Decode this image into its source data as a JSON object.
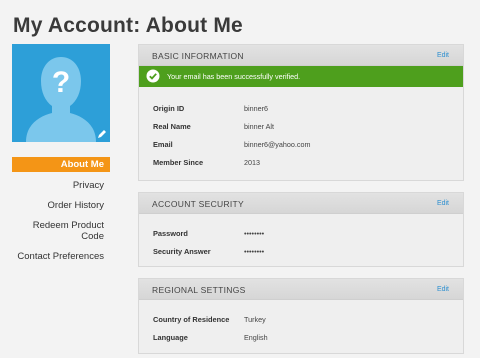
{
  "page": {
    "title": "My Account: About Me"
  },
  "nav": {
    "items": [
      {
        "label": "About Me",
        "active": true
      },
      {
        "label": "Privacy"
      },
      {
        "label": "Order History"
      },
      {
        "label": "Redeem Product Code"
      },
      {
        "label": "Contact Preferences"
      }
    ]
  },
  "colors": {
    "accent": "#f49516",
    "avatar_bg": "#2d9fd8",
    "success": "#4e9f1d",
    "link": "#2d8fd0"
  },
  "basic": {
    "title": "BASIC INFORMATION",
    "edit": "Edit",
    "success": "Your email has been successfully verified.",
    "rows": [
      {
        "label": "Origin ID",
        "value": "binner6"
      },
      {
        "label": "Real Name",
        "value": "binner Alt"
      },
      {
        "label": "Email",
        "value": "binner6@yahoo.com"
      },
      {
        "label": "Member Since",
        "value": "2013"
      }
    ]
  },
  "security": {
    "title": "ACCOUNT SECURITY",
    "edit": "Edit",
    "rows": [
      {
        "label": "Password",
        "value": "••••••••"
      },
      {
        "label": "Security Answer",
        "value": "••••••••"
      }
    ]
  },
  "regional": {
    "title": "REGIONAL SETTINGS",
    "edit": "Edit",
    "rows": [
      {
        "label": "Country of Residence",
        "value": "Turkey"
      },
      {
        "label": "Language",
        "value": "English"
      }
    ]
  }
}
